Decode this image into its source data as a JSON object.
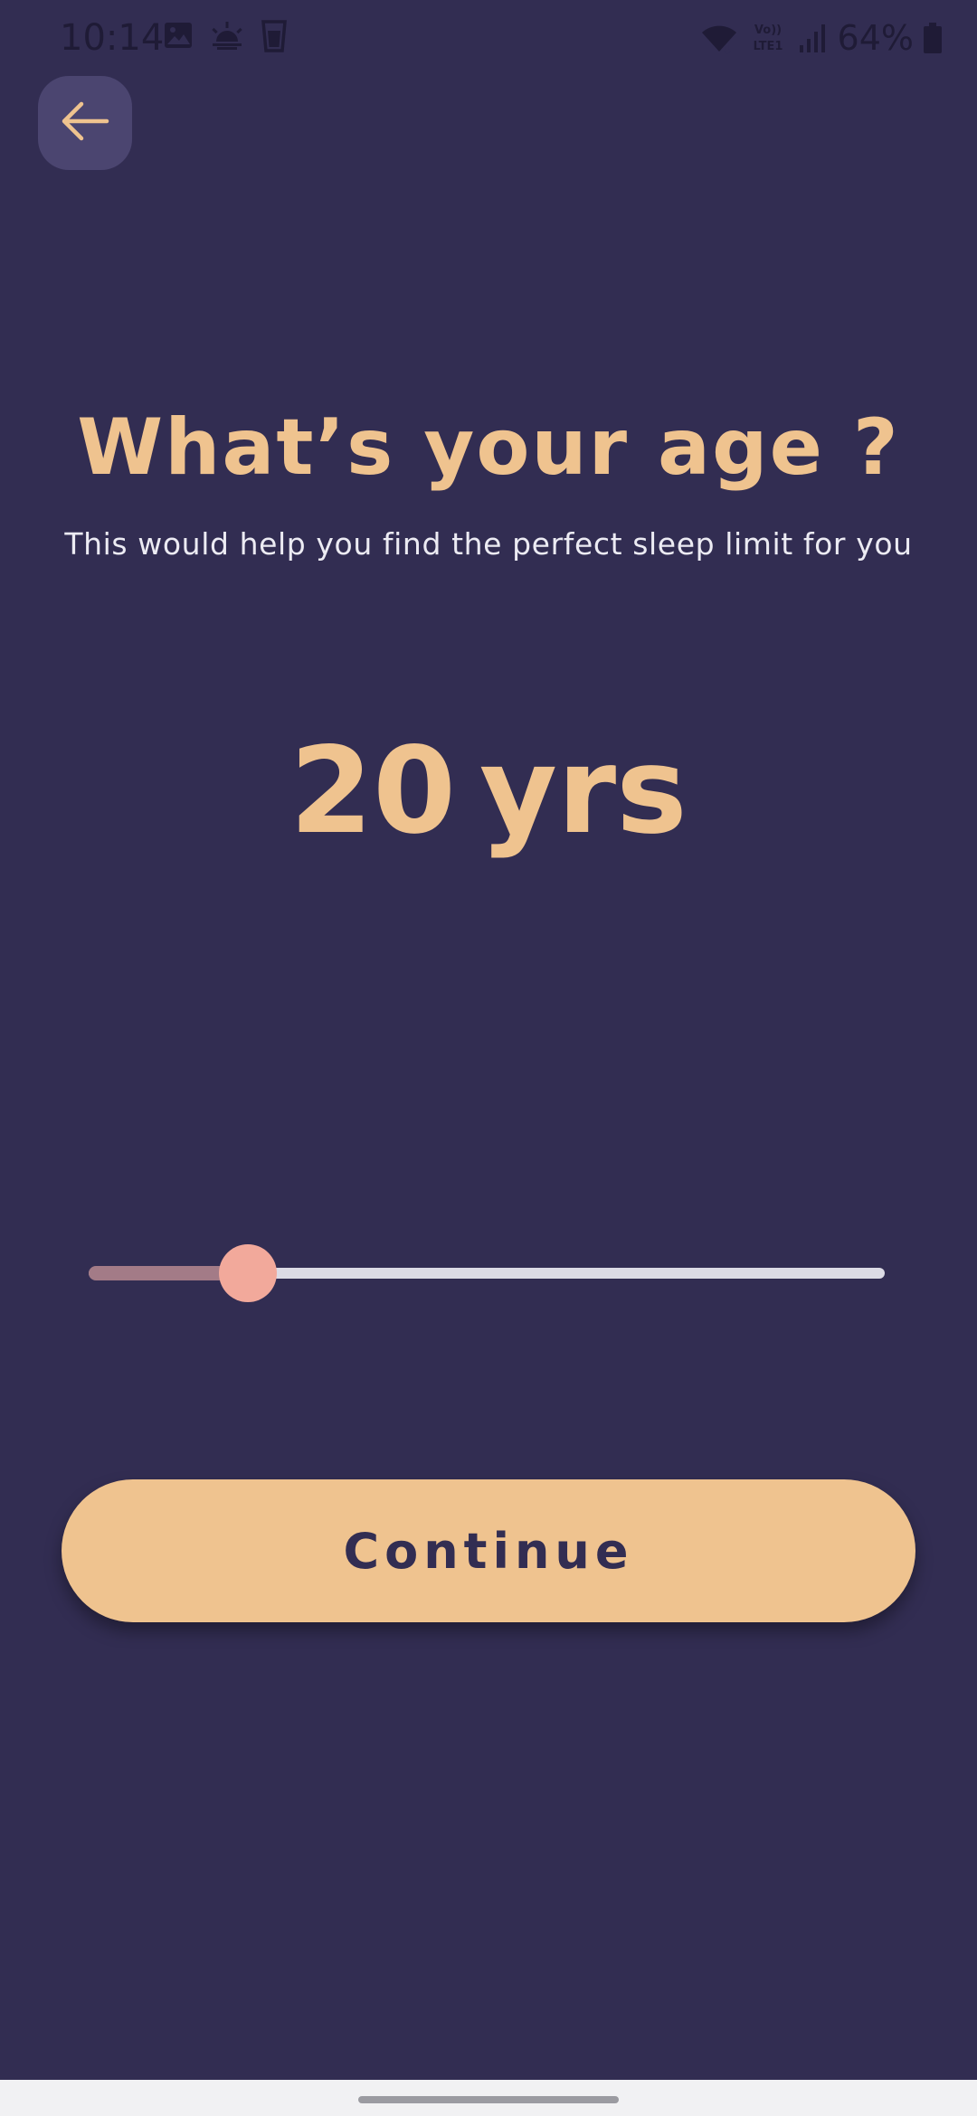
{
  "status_bar": {
    "time": "10:14",
    "notification_icons": [
      "gallery-icon",
      "weather-icon",
      "glass-icon"
    ],
    "system_icons": [
      "wifi-icon",
      "volte-icon",
      "signal-icon"
    ],
    "volte_label": "Vo)) LTE1",
    "battery_percent": "64%"
  },
  "back_button": {
    "icon": "arrow-left-icon"
  },
  "title": "What’s your age ?",
  "subtitle": "This would help you find the perfect sleep limit for you",
  "age": {
    "value": "20",
    "unit": "yrs"
  },
  "slider": {
    "position_fraction": 0.2
  },
  "continue_button": {
    "label": "Continue"
  },
  "colors": {
    "background": "#322d52",
    "accent": "#efc38f",
    "slider_thumb": "#f2a99b",
    "slider_fill": "#a37b87",
    "slider_track": "#dcdbe5",
    "back_button_bg": "#4b4570"
  }
}
